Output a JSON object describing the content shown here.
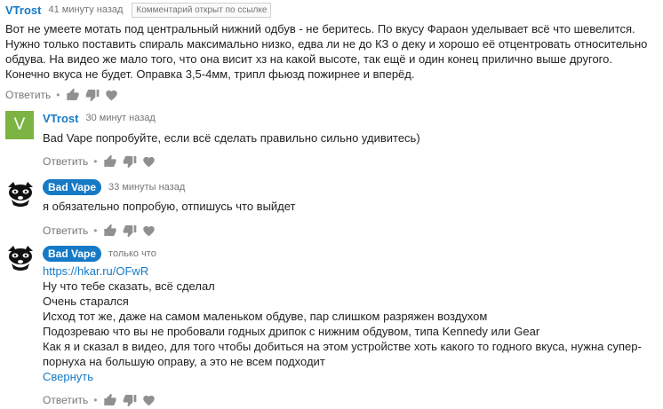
{
  "comments": [
    {
      "author": "VTrost",
      "time": "41 минуту назад",
      "badge": "Комментарий открыт по ссылке",
      "text": "Вот не умеете мотать под центральный нижний одбув - не беритесь. По вкусу Фараон уделывает всё что шевелится.\nНужно только поставить спираль максимально низко, едва ли не до КЗ о деку и хорошо её отцентровать относительно\nобдува. На видео же мало того, что она висит хз на какой высоте, так ещё и один конец прилично выше другого.\nКонечно вкуса не будет. Оправка 3,5-4мм, трипл фьюзд пожирнее и вперёд.",
      "reply": "Ответить"
    },
    {
      "avatar_letter": "V",
      "author": "VTrost",
      "time": "30 минут назад",
      "text": "Bad Vape попробуйте, если всё сделать правильно сильно удивитесь)",
      "reply": "Ответить"
    },
    {
      "author": "Bad Vape",
      "time": "33 минуты назад",
      "text": "я обязательно попробую, отпишусь что выйдет",
      "reply": "Ответить"
    },
    {
      "author": "Bad Vape",
      "time": "только что",
      "link": "https://hkar.ru/OFwR",
      "text": "Ну что тебе сказать, всё сделал\nОчень старался\nИсход тот же, даже на самом маленьком обдуве, пар слишком разряжен воздухом\nПодозреваю что вы не пробовали годных дрипок с нижним обдувом, типа Kennedy или Gear\nКак я и сказал в видео, для того чтобы добиться на этом устройстве хоть какого то годного вкуса, нужна супер-\nпорнуха на большую оправу, а это не всем подходит",
      "collapse": "Свернуть",
      "reply": "Ответить"
    }
  ],
  "icons": {
    "like": "thumb-up-icon",
    "dislike": "thumb-down-icon",
    "heart": "heart-icon",
    "avatar": "raccoon-avatar-icon"
  },
  "colors": {
    "accent": "#167ac6",
    "avatar_bg": "#7cb342",
    "muted": "#767676"
  }
}
